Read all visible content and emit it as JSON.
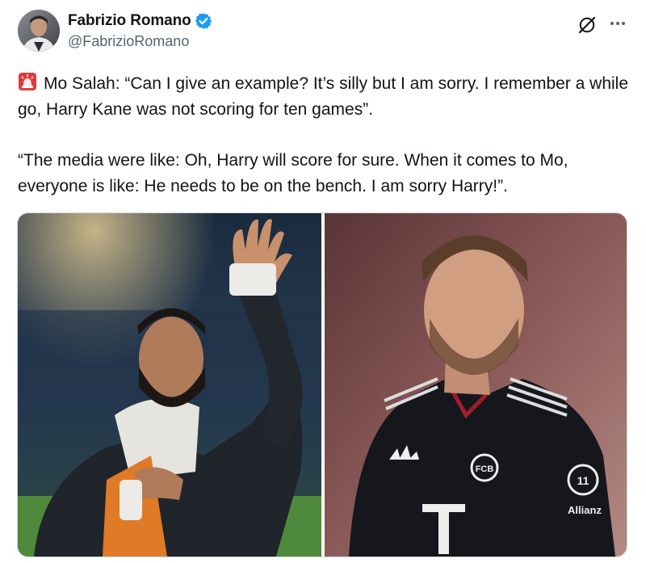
{
  "author": {
    "display_name": "Fabrizio Romano",
    "handle": "@FabrizioRomano",
    "verified": true
  },
  "tweet": {
    "emoji": "siren-emoji",
    "paragraph1": "Mo Salah: “Can I give an example? It’s silly but I am sorry. I remember a while go, Harry Kane was not scoring for ten games”.",
    "paragraph2": "“The media were like: Oh, Harry will score for sure. When it comes to Mo, everyone is like: He needs to be on the bench. I am sorry Harry!”."
  },
  "media": {
    "images": [
      {
        "subject": "man-waving-in-stadium"
      },
      {
        "subject": "footballer-in-black-kit"
      }
    ],
    "kit_text": {
      "sponsor": "Allianz",
      "sponsor_short": "Allian",
      "crest_digits": "11",
      "crest_letters": "FCB",
      "chest_logo": "T"
    }
  },
  "icons": {
    "verified": "verified-badge-icon",
    "grok": "grok-icon",
    "more": "more-dots-icon"
  },
  "colors": {
    "verified_blue": "#1d9bf0",
    "text": "#0f1419",
    "secondary_text": "#536471",
    "border": "#cfd9de",
    "siren_red": "#e03a3e"
  }
}
